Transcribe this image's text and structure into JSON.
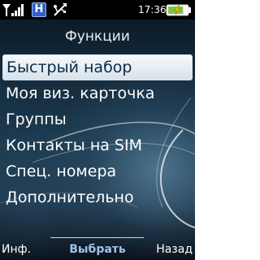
{
  "status_bar": {
    "time": "17:36",
    "network_letter": "H",
    "icons": [
      "signal-icon",
      "network-h-icon",
      "usb-icon",
      "battery-charging-icon"
    ],
    "battery_level": 0.8
  },
  "screen": {
    "title": "Функции",
    "menu_items": [
      "Быстрый набор",
      "Моя виз. карточка",
      "Группы",
      "Контакты на SIM",
      "Спец. номера",
      "Дополнительно"
    ],
    "selected_index": 0
  },
  "softkeys": {
    "left": "Инф.",
    "center": "Выбрать",
    "right": "Назад"
  },
  "colors": {
    "highlight_bg": "#e8eef3",
    "highlight_text": "#0b2a45",
    "center_softkey": "#9fc3ea"
  }
}
